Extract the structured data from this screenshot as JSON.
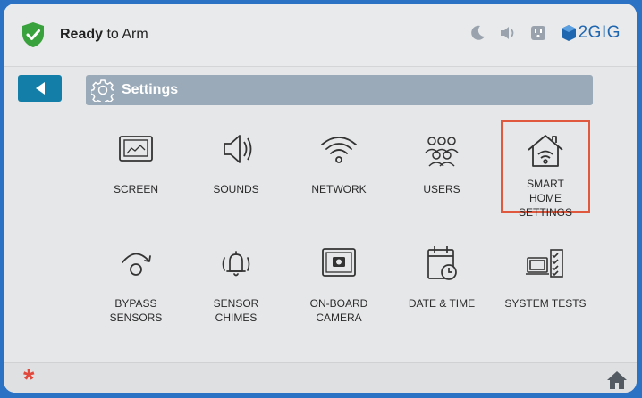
{
  "status": {
    "ready_bold": "Ready",
    "ready_rest": " to Arm"
  },
  "brand": {
    "name": "2GIG"
  },
  "header": {
    "title": "Settings"
  },
  "tiles": [
    {
      "label": "SCREEN",
      "icon": "screen-icon"
    },
    {
      "label": "SOUNDS",
      "icon": "speaker-icon"
    },
    {
      "label": "NETWORK",
      "icon": "wifi-icon"
    },
    {
      "label": "USERS",
      "icon": "users-icon"
    },
    {
      "label": "SMART HOME SETTINGS",
      "icon": "smart-home-icon",
      "selected": true
    },
    {
      "label": "BYPASS SENSORS",
      "icon": "bypass-icon"
    },
    {
      "label": "SENSOR CHIMES",
      "icon": "bell-icon"
    },
    {
      "label": "ON-BOARD CAMERA",
      "icon": "camera-icon"
    },
    {
      "label": "DATE & TIME",
      "icon": "calendar-clock-icon"
    },
    {
      "label": "SYSTEM TESTS",
      "icon": "system-tests-icon"
    }
  ],
  "bottom": {
    "emergency_symbol": "*"
  },
  "colors": {
    "accent": "#137fa8",
    "selection": "#e0583d",
    "brand": "#1f66b0",
    "shield": "#3aa23c"
  }
}
